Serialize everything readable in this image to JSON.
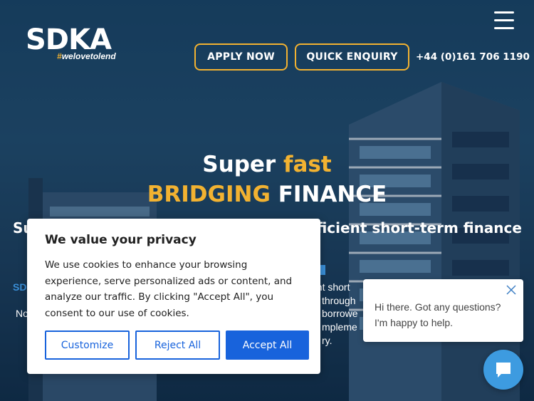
{
  "header": {
    "logo_text": "SDKA",
    "logo_tag_hash": "#",
    "logo_tag": "welovetolend",
    "apply_label": "APPLY NOW",
    "quick_label": "QUICK ENQUIRY",
    "phone": "+44 (0)161 706 1190"
  },
  "hero": {
    "line1_a": "Super ",
    "line1_b": "fast",
    "line2_a": "BRIDGING",
    "line2_b": " FINANCE",
    "sub_left": "Su",
    "sub_right": "fficient short-term finance",
    "sd_frag": "SD",
    "no_frag": "No",
    "frag_lines": [
      "ent short",
      "through",
      "borrowe",
      "mpleme",
      "ry."
    ]
  },
  "cookie": {
    "title": "We value your privacy",
    "body": "We use cookies to enhance your browsing experience, serve personalized ads or content, and analyze our traffic. By clicking \"Accept All\", you consent to our use of cookies.",
    "customize": "Customize",
    "reject": "Reject All",
    "accept": "Accept All"
  },
  "chat": {
    "message": "Hi there. Got any questions? I'm happy to help."
  },
  "colors": {
    "accent": "#f2b231",
    "cookie_blue": "#1863dc",
    "chat_blue": "#3d9be0"
  }
}
